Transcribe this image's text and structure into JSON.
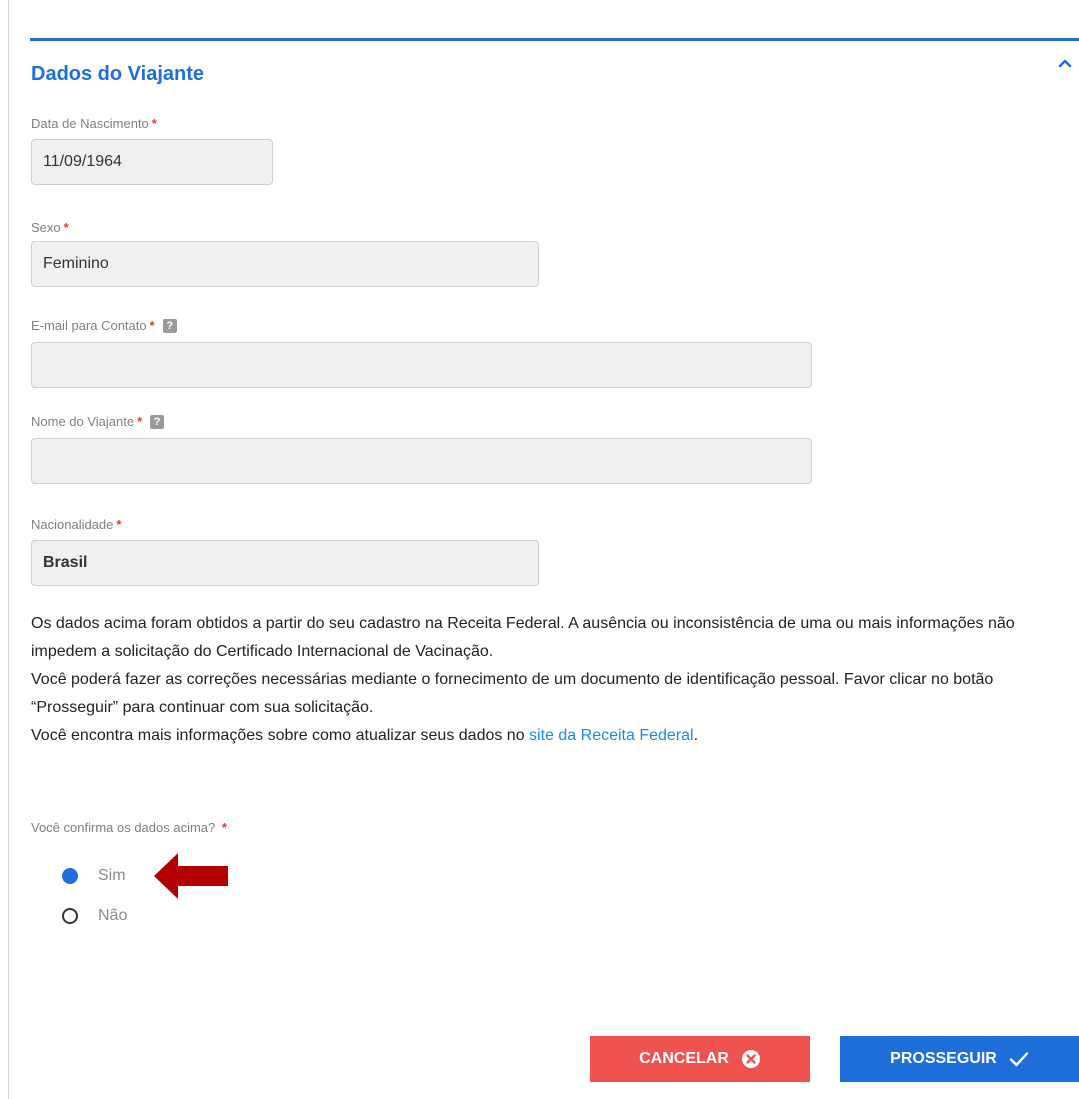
{
  "section": {
    "title": "Dados do Viajante"
  },
  "fields": {
    "birth_date": {
      "label": "Data de Nascimento",
      "required_mark": "*",
      "value": "11/09/1964"
    },
    "sex": {
      "label": "Sexo",
      "required_mark": "*",
      "value": "Feminino"
    },
    "email": {
      "label": "E-mail para Contato",
      "required_mark": "*",
      "help": "?",
      "value": ""
    },
    "name": {
      "label": "Nome do Viajante",
      "required_mark": "*",
      "help": "?",
      "value": ""
    },
    "nationality": {
      "label": "Nacionalidade",
      "required_mark": "*",
      "value": "Brasil"
    }
  },
  "info": {
    "line1": "Os dados acima foram obtidos a partir do seu cadastro na Receita Federal. A ausência ou inconsistência de uma ou mais informações não impedem a solicitação do Certificado Internacional de Vacinação.",
    "line2": "Você poderá fazer as correções necessárias mediante o fornecimento de um documento de identificação pessoal. Favor clicar no botão “Prosseguir” para continuar com sua solicitação.",
    "line3_prefix": "Você encontra mais informações sobre como atualizar seus dados no ",
    "link_text": "site da Receita Federal",
    "line3_suffix": "."
  },
  "confirm": {
    "label": "Você confirma os dados acima?",
    "required_mark": "*",
    "options": [
      {
        "label": "Sim",
        "selected": true
      },
      {
        "label": "Não",
        "selected": false
      }
    ]
  },
  "buttons": {
    "cancel": "CANCELAR",
    "proceed": "PROSSEGUIR"
  },
  "colors": {
    "accent": "#1e6fd9",
    "danger": "#ef5350",
    "annotation_arrow": "#b40000"
  },
  "icons": {
    "collapse": "chevron-up-icon",
    "cancel": "close-circle-icon",
    "proceed": "check-icon",
    "annotation": "arrow-left-icon"
  }
}
